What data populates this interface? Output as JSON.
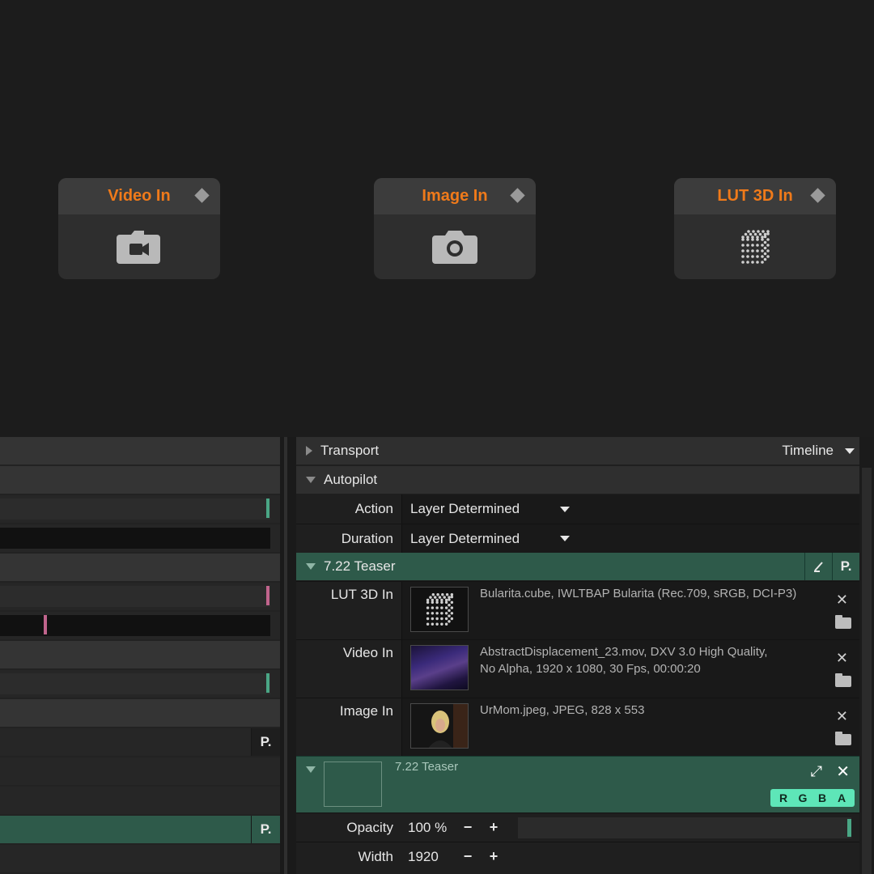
{
  "nodes": [
    {
      "title": "Video In",
      "icon": "video-camera-icon"
    },
    {
      "title": "Image In",
      "icon": "photo-camera-icon"
    },
    {
      "title": "LUT 3D In",
      "icon": "lut-cube-icon"
    }
  ],
  "colors": {
    "accent": "#f07a1a",
    "teal": "#2e5a4a",
    "rgba_badge": "#5ee6b8",
    "tick_teal": "#4aa685",
    "tick_pink": "#c0648c"
  },
  "left_panel": {
    "p_label": "P."
  },
  "inspector": {
    "transport": {
      "label": "Transport",
      "mode": "Timeline"
    },
    "autopilot": {
      "label": "Autopilot",
      "action": {
        "label": "Action",
        "value": "Layer Determined"
      },
      "duration": {
        "label": "Duration",
        "value": "Layer Determined"
      }
    },
    "clip": {
      "label": "7.22 Teaser",
      "edit_icon": "pencil-icon",
      "p_label": "P.",
      "assets": [
        {
          "label": "LUT 3D In",
          "line1": "Bularita.cube, IWLTBAP Bularita (Rec.709, sRGB, DCI-P3)",
          "line2": ""
        },
        {
          "label": "Video In",
          "line1": "AbstractDisplacement_23.mov, DXV 3.0 High Quality,",
          "line2": "No Alpha, 1920 x 1080, 30 Fps, 00:00:20"
        },
        {
          "label": "Image In",
          "line1": "UrMom.jpeg, JPEG, 828 x 553",
          "line2": ""
        }
      ]
    },
    "layer": {
      "title": "7.22 Teaser",
      "channels": [
        "R",
        "G",
        "B",
        "A"
      ],
      "opacity": {
        "label": "Opacity",
        "value": "100 %",
        "minus": "−",
        "plus": "+",
        "level": 1.0
      },
      "width": {
        "label": "Width",
        "value": "1920",
        "minus": "−",
        "plus": "+"
      }
    }
  }
}
